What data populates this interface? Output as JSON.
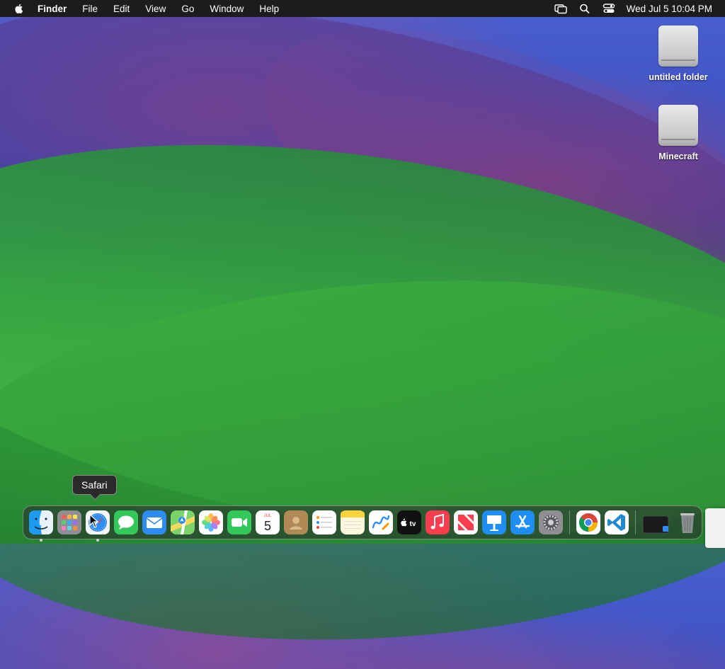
{
  "menubar": {
    "apple_icon": "apple-logo",
    "items": [
      "Finder",
      "File",
      "Edit",
      "View",
      "Go",
      "Window",
      "Help"
    ],
    "status_icons": [
      "screen-mirroring-icon",
      "spotlight-search-icon",
      "control-center-icon"
    ],
    "clock": "Wed Jul 5  10:04 PM"
  },
  "desktop": {
    "icons": [
      {
        "label": "untitled folder",
        "icon": "external-drive-icon"
      },
      {
        "label": "Minecraft",
        "icon": "external-drive-icon"
      }
    ]
  },
  "tooltip": {
    "text": "Safari"
  },
  "dock": {
    "apps": [
      {
        "name": "Finder",
        "running": true
      },
      {
        "name": "Launchpad",
        "running": false
      },
      {
        "name": "Safari",
        "running": true
      },
      {
        "name": "Messages",
        "running": false
      },
      {
        "name": "Mail",
        "running": false
      },
      {
        "name": "Maps",
        "running": false
      },
      {
        "name": "Photos",
        "running": false
      },
      {
        "name": "FaceTime",
        "running": false
      },
      {
        "name": "Calendar",
        "running": false,
        "month": "JUL",
        "day": "5"
      },
      {
        "name": "Contacts",
        "running": false
      },
      {
        "name": "Reminders",
        "running": false
      },
      {
        "name": "Notes",
        "running": false
      },
      {
        "name": "Freeform",
        "running": false
      },
      {
        "name": "TV",
        "running": false,
        "label": "tv"
      },
      {
        "name": "Music",
        "running": false
      },
      {
        "name": "News",
        "running": false
      },
      {
        "name": "Keynote",
        "running": false
      },
      {
        "name": "App Store",
        "running": false
      },
      {
        "name": "System Settings",
        "running": false
      },
      {
        "name": "Google Chrome",
        "running": false
      },
      {
        "name": "Visual Studio Code",
        "running": false
      },
      {
        "name": "Downloads",
        "running": false
      },
      {
        "name": "Trash",
        "running": false
      }
    ]
  },
  "colors": {
    "menubar_bg": "#1c1c1e",
    "wallpaper_blue": "#3b4fc0",
    "wallpaper_green": "#4fc74d",
    "wallpaper_magenta": "#b0467a"
  }
}
